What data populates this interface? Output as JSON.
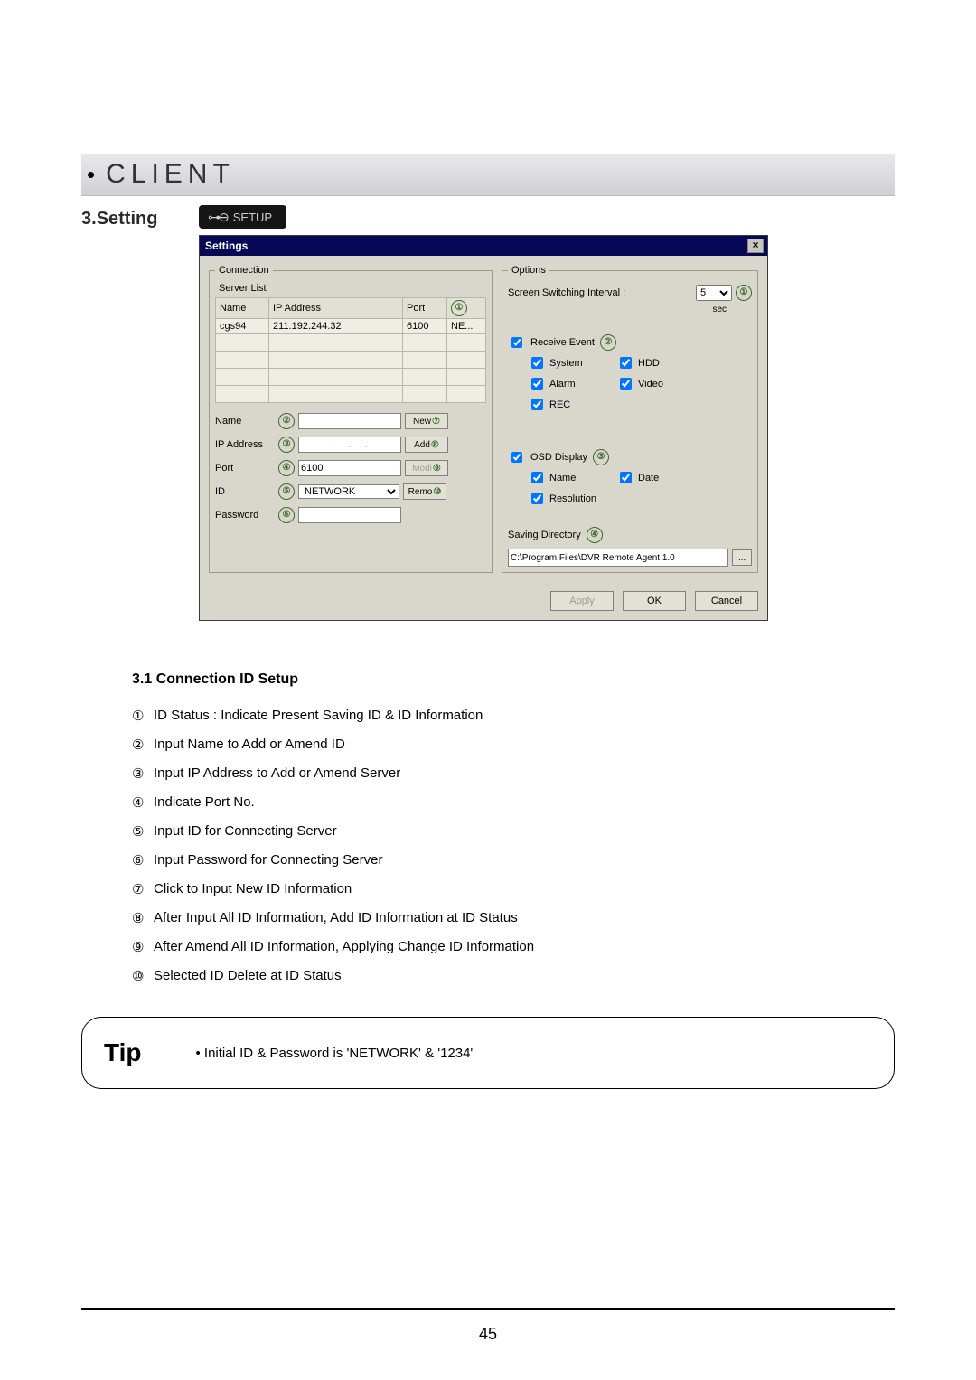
{
  "section": {
    "dot": "•",
    "title": "CLIENT",
    "settingLabel": "3.Setting",
    "setupPill": {
      "glyph": "⊶⊖",
      "text": "SETUP"
    }
  },
  "dialog": {
    "title": "Settings",
    "closeGlyph": "×",
    "connection": {
      "legend": "Connection",
      "serverListLabel": "Server List",
      "headers": {
        "name": "Name",
        "ip": "IP Address",
        "port": "Port",
        "net": ""
      },
      "row": {
        "name": "cgs94",
        "ip": "211.192.244.32",
        "port": "6100",
        "net": "NE..."
      },
      "badge_table": "①",
      "fields": {
        "name": {
          "label": "Name",
          "badge": "②",
          "value": ""
        },
        "ip": {
          "label": "IP Address",
          "badge": "③",
          "value": ".     .     ."
        },
        "port": {
          "label": "Port",
          "badge": "④",
          "value": "6100"
        },
        "id": {
          "label": "ID",
          "badge": "⑤",
          "value": "NETWORK"
        },
        "password": {
          "label": "Password",
          "badge": "⑥",
          "value": ""
        }
      },
      "buttons": {
        "new": {
          "label": "New",
          "badge": "⑦"
        },
        "add": {
          "label": "Add",
          "badge": "⑧"
        },
        "modify": {
          "label": "Modi",
          "badge": "⑨"
        },
        "remove": {
          "label": "Remo",
          "badge": "⑩"
        }
      }
    },
    "options": {
      "legend": "Options",
      "screenSwitch": {
        "label": "Screen Switching Interval :",
        "value": "5",
        "unit": "sec",
        "badge": "①"
      },
      "receiveEvent": {
        "label": "Receive Event",
        "badge": "②",
        "subs": {
          "system": "System",
          "hdd": "HDD",
          "alarm": "Alarm",
          "video": "Video",
          "rec": "REC"
        }
      },
      "osd": {
        "label": "OSD Display",
        "badge": "③",
        "subs": {
          "name": "Name",
          "date": "Date",
          "resolution": "Resolution"
        }
      },
      "savingDir": {
        "label": "Saving Directory",
        "badge": "④",
        "path": "C:\\Program Files\\DVR Remote Agent 1.0",
        "browse": "..."
      }
    },
    "footer": {
      "apply": "Apply",
      "ok": "OK",
      "cancel": "Cancel"
    }
  },
  "instructions": {
    "title": "3.1 Connection ID Setup",
    "items": [
      {
        "num": "①",
        "text": "ID Status : Indicate Present Saving ID & ID Information"
      },
      {
        "num": "②",
        "text": "Input Name to Add or Amend ID"
      },
      {
        "num": "③",
        "text": "Input IP Address to Add or Amend Server"
      },
      {
        "num": "④",
        "text": "Indicate Port No."
      },
      {
        "num": "⑤",
        "text": "Input ID for Connecting Server"
      },
      {
        "num": "⑥",
        "text": "Input Password for Connecting Server"
      },
      {
        "num": "⑦",
        "text": "Click to Input New ID Information"
      },
      {
        "num": "⑧",
        "text": "After Input All ID Information, Add ID Information at ID Status"
      },
      {
        "num": "⑨",
        "text": "After Amend All ID Information, Applying Change ID Information"
      },
      {
        "num": "⑩",
        "text": "Selected ID Delete at ID Status"
      }
    ]
  },
  "tip": {
    "header": "Tip",
    "bullet": "•",
    "text": "Initial ID & Password is 'NETWORK' & '1234'"
  },
  "pageNumber": "45"
}
